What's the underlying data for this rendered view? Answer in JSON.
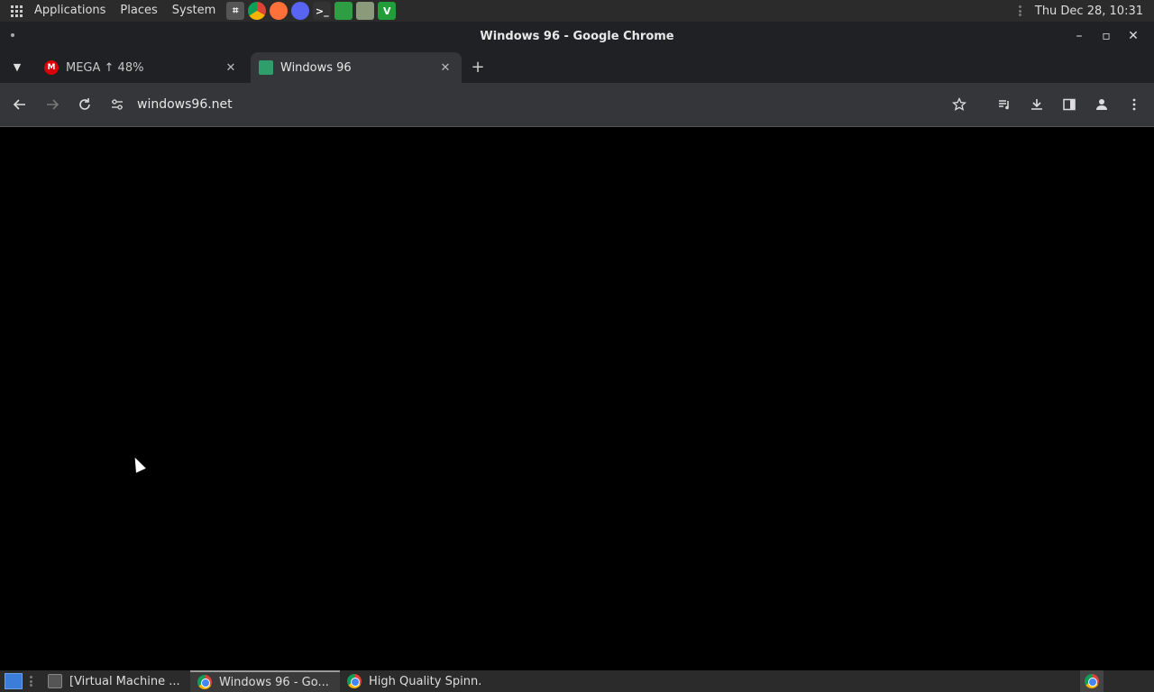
{
  "top_panel": {
    "menus": [
      "Applications",
      "Places",
      "System"
    ],
    "launchers": [
      {
        "name": "screenshot-icon",
        "glyph": "⌗",
        "color": "#555555"
      },
      {
        "name": "chrome-icon",
        "glyph": "",
        "color": "#db4437"
      },
      {
        "name": "firefox-icon",
        "glyph": "",
        "color": "#ff7139"
      },
      {
        "name": "discord-icon",
        "glyph": "",
        "color": "#5865f2"
      },
      {
        "name": "terminal-icon",
        "glyph": ">_",
        "color": "#333333"
      },
      {
        "name": "system-monitor-icon",
        "glyph": "",
        "color": "#2e9e44"
      },
      {
        "name": "file-manager-icon",
        "glyph": "",
        "color": "#8a9a7a"
      },
      {
        "name": "vim-icon",
        "glyph": "V",
        "color": "#1f9e3a"
      }
    ],
    "clock": "Thu Dec 28, 10:31"
  },
  "window": {
    "title": "Windows 96 - Google Chrome",
    "controls": {
      "minimize": "–",
      "maximize": "▫",
      "close": "✕"
    }
  },
  "tabs": [
    {
      "title": "MEGA ↑ 48%",
      "favicon_color": "#d90007",
      "favicon_text": "M",
      "active": false
    },
    {
      "title": "Windows 96",
      "favicon_color": "#2e9e6a",
      "favicon_text": "",
      "active": true
    }
  ],
  "toolbar": {
    "url": "windows96.net"
  },
  "taskbar": {
    "tasks": [
      {
        "label": "[Virtual Machine ...",
        "active": false
      },
      {
        "label": "Windows 96 - Go...",
        "active": true
      },
      {
        "label": "High Quality Spinn...",
        "active": false
      }
    ]
  },
  "colors": {
    "panel_bg": "#2b2b2b",
    "chrome_frame": "#202124",
    "chrome_toolbar": "#35363a",
    "content_bg": "#000000"
  }
}
